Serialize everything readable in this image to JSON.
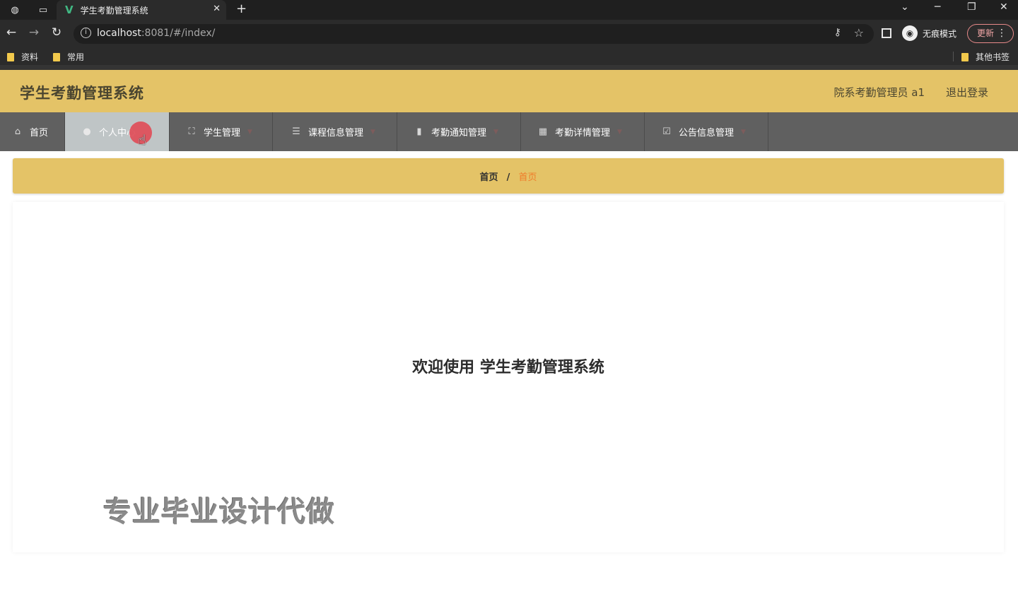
{
  "browser": {
    "tab_title": "学生考勤管理系统",
    "url_host": "localhost",
    "url_rest": ":8081/#/index/",
    "incognito_label": "无痕模式",
    "update_label": "更新",
    "bookmarks": [
      "资料",
      "常用"
    ],
    "other_bookmarks": "其他书签"
  },
  "app": {
    "title": "学生考勤管理系统",
    "user_info": "院系考勤管理员 a1",
    "logout": "退出登录"
  },
  "menu": {
    "items": [
      {
        "label": "首页",
        "icon": "home-icon"
      },
      {
        "label": "个人中心",
        "icon": "user-icon"
      },
      {
        "label": "学生管理",
        "icon": "scan-icon"
      },
      {
        "label": "课程信息管理",
        "icon": "list-icon"
      },
      {
        "label": "考勤通知管理",
        "icon": "bar-chart-icon"
      },
      {
        "label": "考勤详情管理",
        "icon": "grid-icon"
      },
      {
        "label": "公告信息管理",
        "icon": "checkbox-icon"
      }
    ],
    "active_index": 1
  },
  "breadcrumb": {
    "home": "首页",
    "separator": "/",
    "current": "首页"
  },
  "main": {
    "welcome": "欢迎使用 学生考勤管理系统",
    "watermark": "专业毕业设计代做"
  },
  "colors": {
    "accent": "#e4c367",
    "menu_bg": "#606060",
    "crumb_active": "#f07b2a"
  }
}
